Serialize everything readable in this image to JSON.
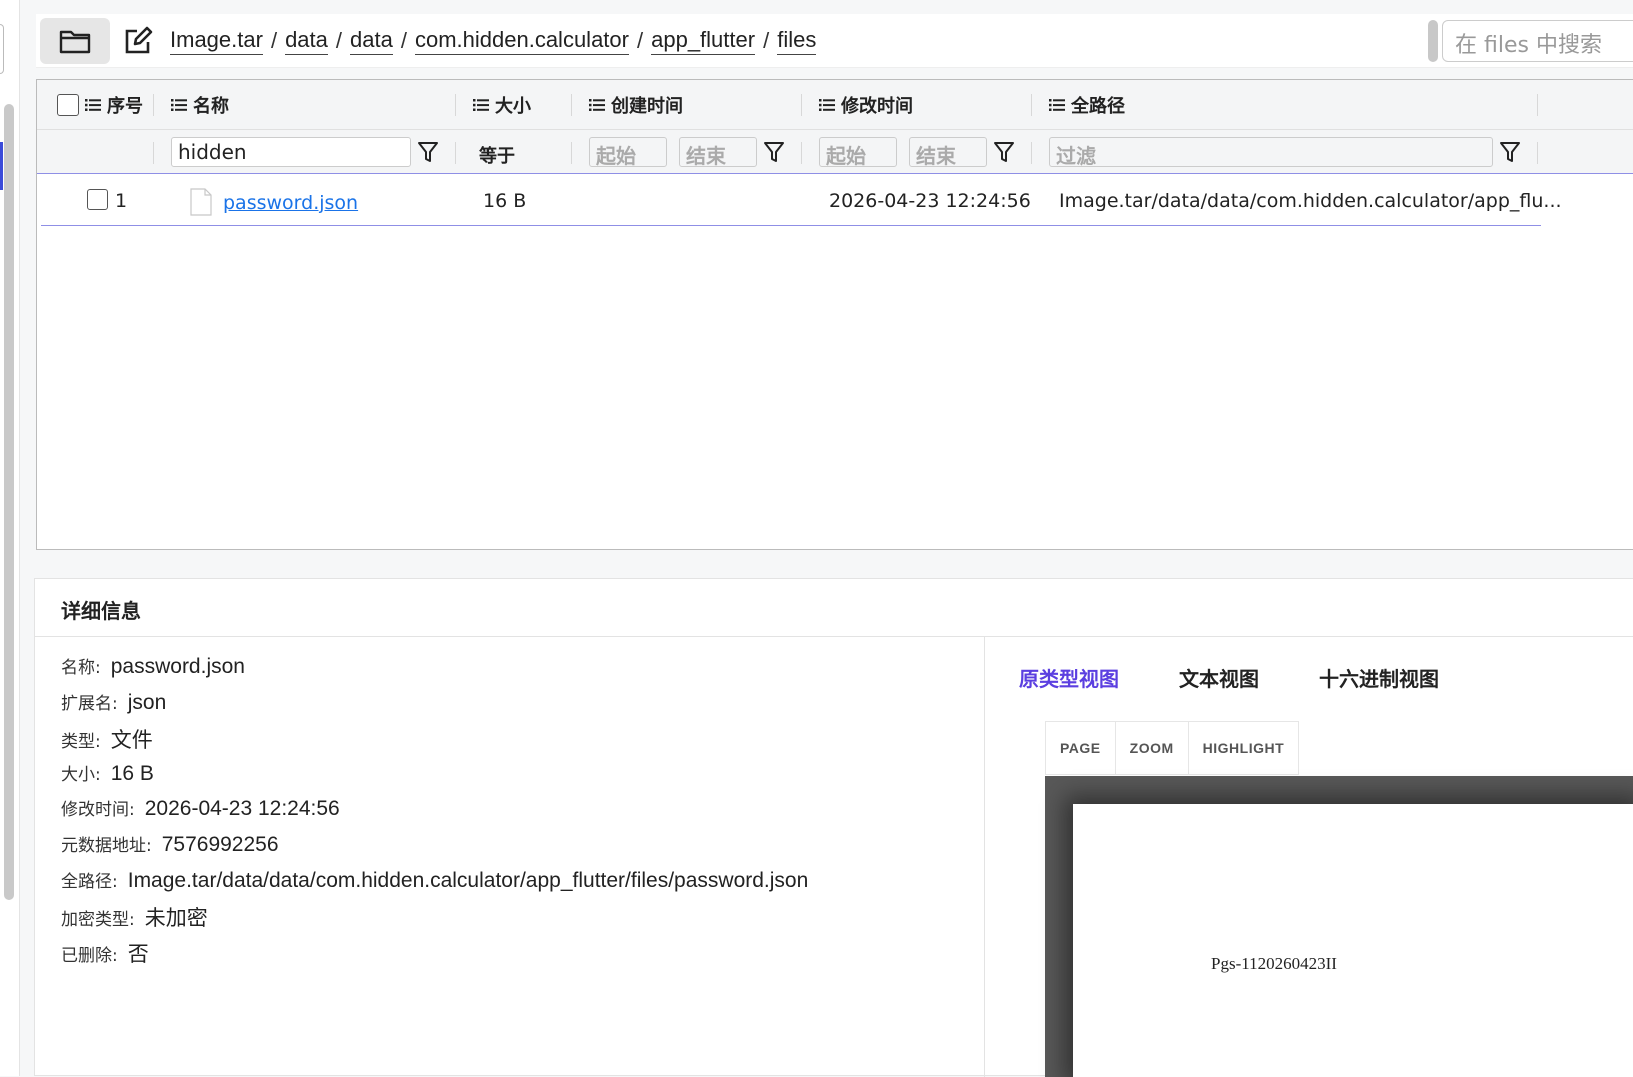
{
  "toolbar": {
    "breadcrumb": [
      "Image.tar",
      "data",
      "data",
      "com.hidden.calculator",
      "app_flutter",
      "files"
    ],
    "search_placeholder": "在 files 中搜索"
  },
  "table": {
    "columns": {
      "index": "序号",
      "name": "名称",
      "size": "大小",
      "created": "创建时间",
      "modified": "修改时间",
      "fullpath": "全路径"
    },
    "filters": {
      "name_value": "hidden",
      "size_op": "等于",
      "created_start": "起始",
      "created_end": "结束",
      "modified_start": "起始",
      "modified_end": "结束",
      "path_placeholder": "过滤"
    },
    "rows": [
      {
        "index": "1",
        "name": "password.json",
        "size": "16 B",
        "created": "",
        "modified": "2026-04-23 12:24:56",
        "fullpath": "Image.tar/data/data/com.hidden.calculator/app_flu..."
      }
    ]
  },
  "details": {
    "title": "详细信息",
    "items": [
      {
        "label": "名称:",
        "value": "password.json"
      },
      {
        "label": "扩展名:",
        "value": "json"
      },
      {
        "label": "类型:",
        "value": "文件"
      },
      {
        "label": "大小:",
        "value": "16 B"
      },
      {
        "label": "修改时间:",
        "value": "2026-04-23 12:24:56"
      },
      {
        "label": "元数据地址:",
        "value": "7576992256"
      },
      {
        "label": "全路径:",
        "value": "Image.tar/data/data/com.hidden.calculator/app_flutter/files/password.json"
      },
      {
        "label": "加密类型:",
        "value": "未加密"
      },
      {
        "label": "已删除:",
        "value": "否"
      }
    ],
    "view_tabs": [
      "原类型视图",
      "文本视图",
      "十六进制视图"
    ],
    "active_tab": "原类型视图",
    "viewer": {
      "buttons": [
        "PAGE",
        "ZOOM",
        "HIGHLIGHT"
      ],
      "page_text": "Pgs-1120260423II"
    }
  },
  "colors": {
    "accent": "#5b3fe0",
    "link": "#1a73e8",
    "row_border": "#8f8fe6"
  }
}
